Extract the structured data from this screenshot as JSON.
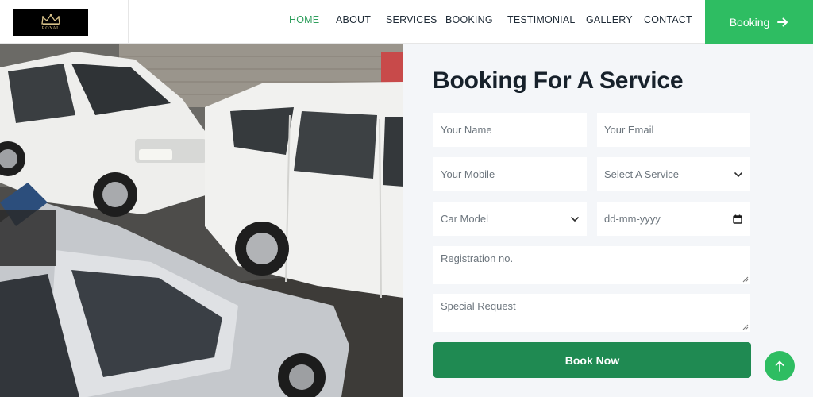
{
  "brand": {
    "logo_text": "ROYAL"
  },
  "nav": {
    "items": [
      {
        "label": "HOME",
        "active": true
      },
      {
        "label": "ABOUT",
        "active": false
      },
      {
        "label": "SERVICES",
        "active": false
      },
      {
        "label": "BOOKING",
        "active": false
      },
      {
        "label": "TESTIMONIAL",
        "active": false
      },
      {
        "label": "GALLERY",
        "active": false
      },
      {
        "label": "CONTACT",
        "active": false
      }
    ],
    "cta_label": "Booking"
  },
  "form": {
    "title": "Booking For A Service",
    "name_placeholder": "Your Name",
    "email_placeholder": "Your Email",
    "mobile_placeholder": "Your Mobile",
    "service_selected": "Select A Service",
    "car_model_selected": "Car Model",
    "date_placeholder": "dd-mm-yyyy",
    "registration_placeholder": "Registration no.",
    "request_placeholder": "Special Request",
    "submit_label": "Book Now"
  },
  "colors": {
    "accent": "#2ebd62",
    "submit": "#1f8a52",
    "active_nav": "#2e9e5c",
    "panel_bg": "#f4f6f9"
  },
  "icons": {
    "cta": "arrow-right-icon",
    "scroll_top": "arrow-up-icon",
    "select": "chevron-down-icon",
    "date": "calendar-icon"
  }
}
